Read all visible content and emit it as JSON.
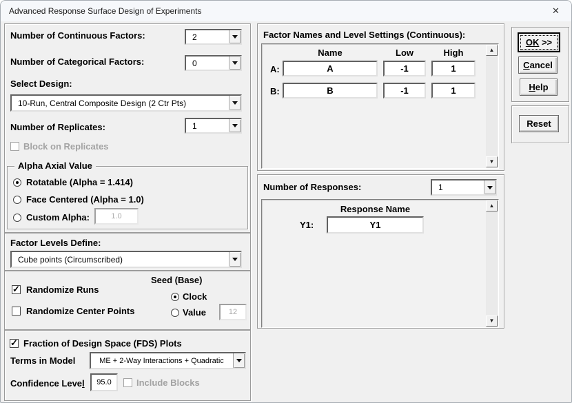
{
  "window": {
    "title": "Advanced Response Surface Design of Experiments"
  },
  "icons": {
    "close": "✕",
    "check": "✓",
    "up_arrow": "▲",
    "down_arrow": "▼"
  },
  "left": {
    "continuous_label": "Number of Continuous Factors:",
    "continuous_value": "2",
    "categorical_label": "Number of Categorical Factors:",
    "categorical_value": "0",
    "design_label": "Select Design:",
    "design_value": "10-Run, Central Composite Design (2 Ctr Pts)",
    "replicates_label": "Number of Replicates:",
    "replicates_value": "1",
    "block_label": "Block on Replicates",
    "alpha": {
      "title": "Alpha Axial Value",
      "rotatable": "Rotatable (Alpha = 1.414)",
      "face_centered": "Face Centered (Alpha = 1.0)",
      "custom": "Custom Alpha:",
      "custom_value": "1.0"
    },
    "levels_label": "Factor Levels Define:",
    "levels_value": "Cube points (Circumscribed)",
    "randomize": {
      "runs": "Randomize Runs",
      "center_points": "Randomize Center Points",
      "seed_title": "Seed (Base)",
      "clock": "Clock",
      "value": "Value",
      "seed_value": "12"
    },
    "fds": {
      "label": "Fraction of Design Space (FDS) Plots",
      "terms_label": "Terms in Model",
      "terms_value": "ME + 2-Way Interactions + Quadratic",
      "confidence_prefix": "Confidence Leve",
      "confidence_mnemonic": "l",
      "confidence_value": "95.0",
      "include_blocks": "Include Blocks"
    }
  },
  "factors": {
    "title": "Factor Names and Level Settings (Continuous):",
    "col_name": "Name",
    "col_low": "Low",
    "col_high": "High",
    "rows": [
      {
        "label": "A:",
        "name": "A",
        "low": "-1",
        "high": "1"
      },
      {
        "label": "B:",
        "name": "B",
        "low": "-1",
        "high": "1"
      }
    ]
  },
  "responses": {
    "label": "Number of Responses:",
    "value": "1",
    "col": "Response Name",
    "rows": [
      {
        "label": "Y1:",
        "name": "Y1"
      }
    ]
  },
  "buttons": {
    "ok_mnemonic": "OK",
    "ok_rest": " >>",
    "cancel_mnemonic": "C",
    "cancel_rest": "ancel",
    "help_mnemonic": "H",
    "help_rest": "elp",
    "reset": "Reset"
  }
}
